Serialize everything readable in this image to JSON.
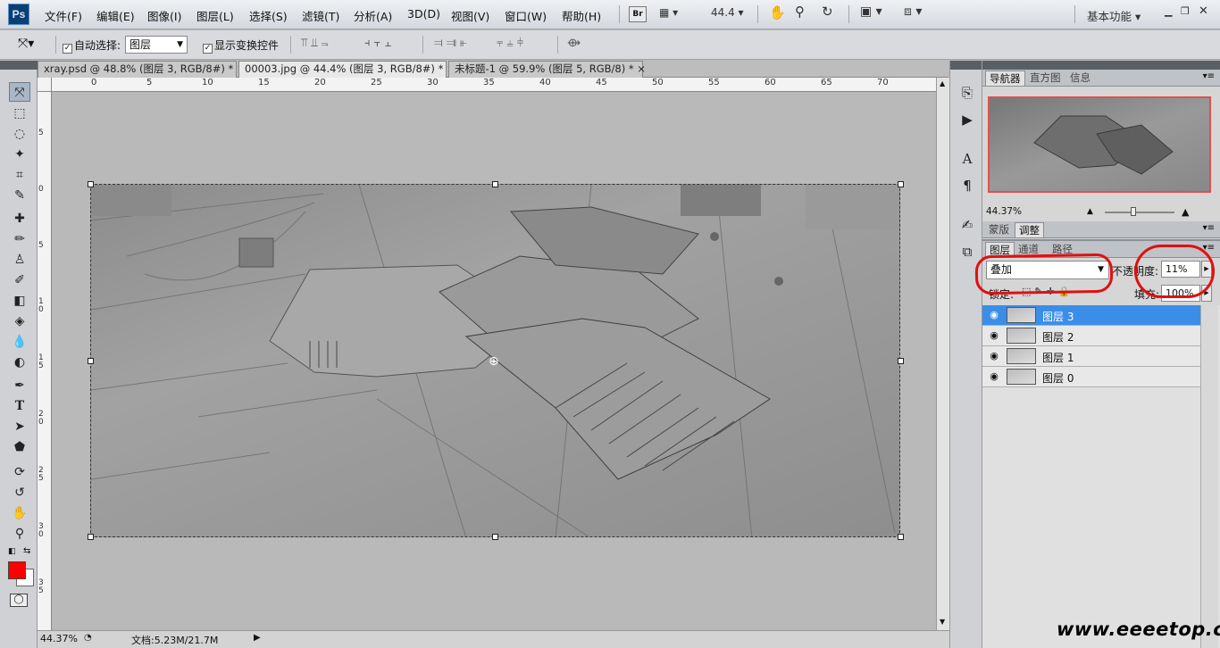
{
  "app": {
    "logo": "Ps"
  },
  "menubar": {
    "items": [
      "文件(F)",
      "编辑(E)",
      "图像(I)",
      "图层(L)",
      "选择(S)",
      "滤镜(T)",
      "分析(A)",
      "3D(D)",
      "视图(V)",
      "窗口(W)",
      "帮助(H)"
    ],
    "bridge_label": "Br",
    "zoom_value": "44.4",
    "workspace": "基本功能"
  },
  "options": {
    "auto_select_label": "自动选择:",
    "auto_select_target": "图层",
    "show_transform_label": "显示变换控件"
  },
  "tabs": [
    {
      "label": "xray.psd @ 48.8% (图层 3, RGB/8#) *",
      "close": "×"
    },
    {
      "label": "00003.jpg @ 44.4% (图层 3, RGB/8#) *",
      "close": "×"
    },
    {
      "label": "未标题-1 @ 59.9% (图层 5, RGB/8) *",
      "close": "×"
    }
  ],
  "rulers": {
    "h_ticks": [
      "0",
      "5",
      "10",
      "15",
      "20",
      "25",
      "30",
      "35",
      "40",
      "45",
      "50",
      "55",
      "60",
      "65",
      "70"
    ],
    "v_ticks": [
      "5",
      "0",
      "5",
      "1 0",
      "1 5",
      "2 0",
      "2 5",
      "3 0",
      "3 5"
    ]
  },
  "status": {
    "zoom": "44.37%",
    "doc": "文档:5.23M/21.7M"
  },
  "navigator": {
    "tabs": [
      "导航器",
      "直方图",
      "信息"
    ],
    "zoom": "44.37%"
  },
  "adjust_panel": {
    "tabs": [
      "蒙版",
      "调整"
    ]
  },
  "layers_panel": {
    "tabs": [
      "图层",
      "通道",
      "路径"
    ],
    "blend_mode": "叠加",
    "opacity_label": "不透明度:",
    "opacity_value": "11%",
    "lock_label": "锁定:",
    "fill_label": "填充:",
    "fill_value": "100%",
    "layers": [
      {
        "name": "图层 3",
        "selected": true
      },
      {
        "name": "图层 2",
        "selected": false
      },
      {
        "name": "图层 1",
        "selected": false
      },
      {
        "name": "图层 0",
        "selected": false
      }
    ]
  },
  "watermark": "www.eeeetop.com",
  "colors": {
    "foreground": "#ff0000",
    "background": "#ffffff",
    "annotation": "#e01010"
  }
}
